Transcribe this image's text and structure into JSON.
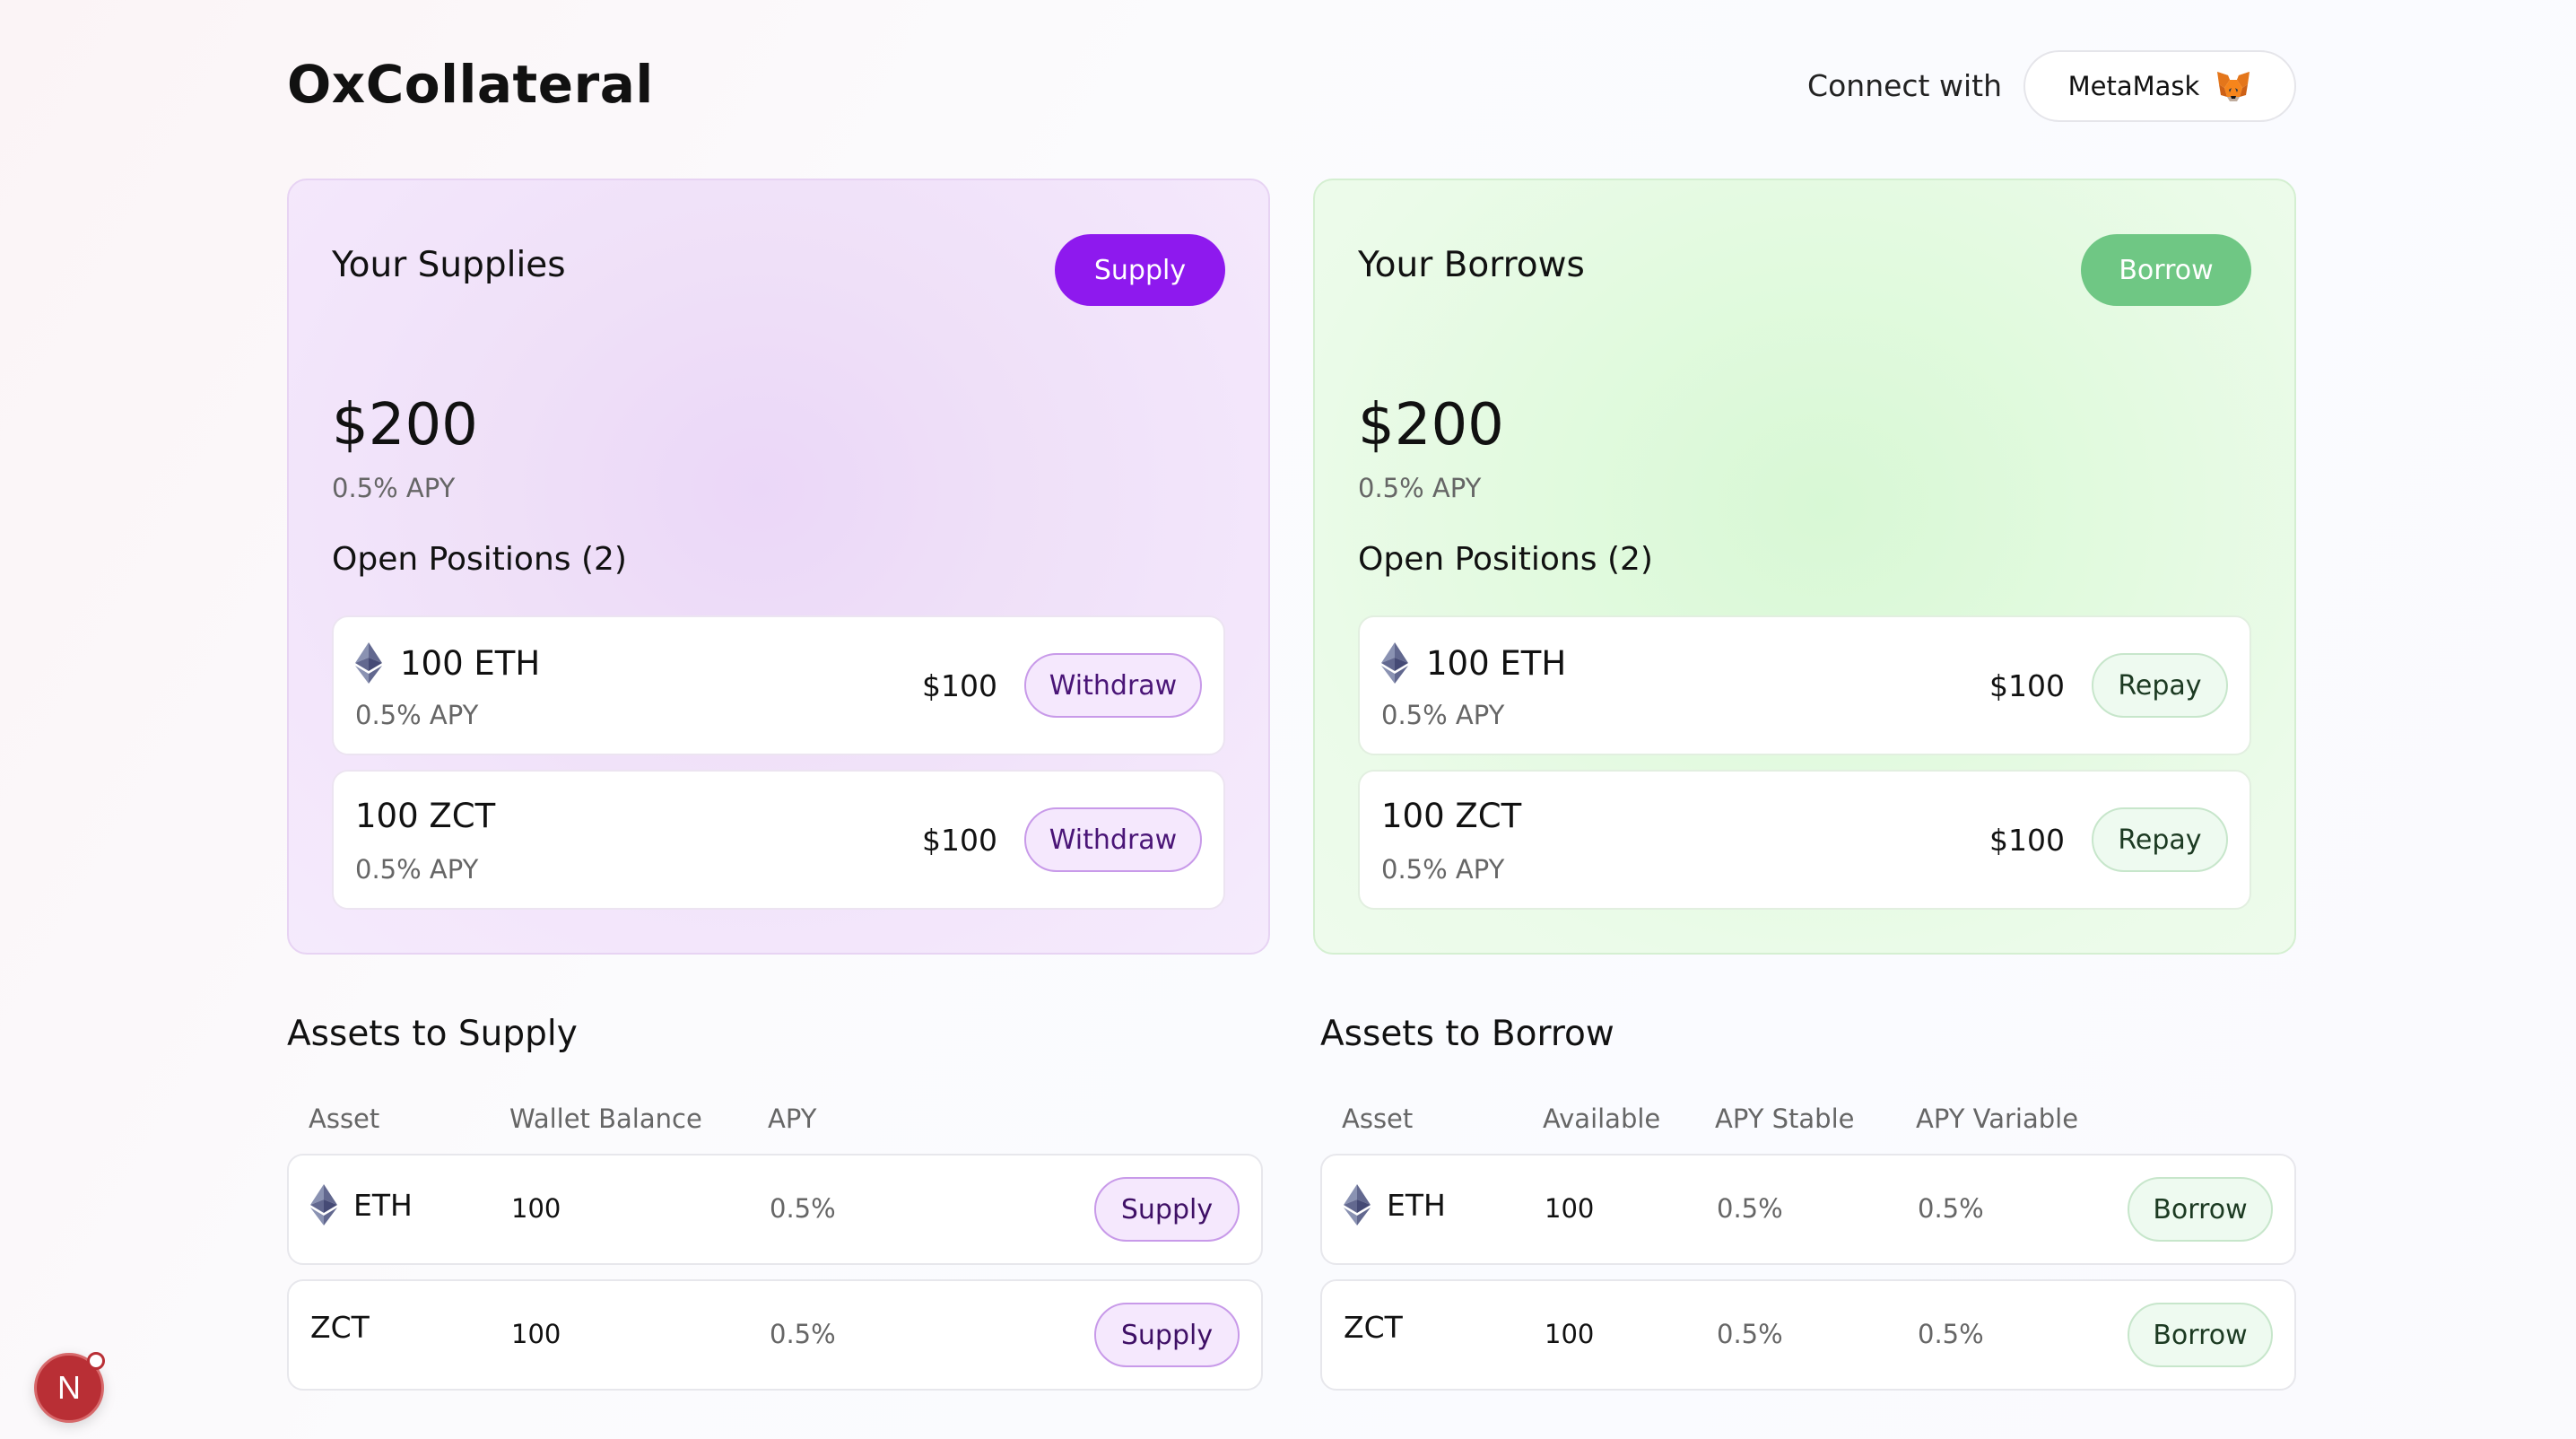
{
  "header": {
    "logo": "OxCollateral",
    "connect_label": "Connect with",
    "wallet_button": "MetaMask",
    "wallet_icon": "metamask-fox-icon"
  },
  "supplies_card": {
    "title": "Your Supplies",
    "action_label": "Supply",
    "amount": "$200",
    "apy": "0.5% APY",
    "open_positions_label": "Open Positions (2)",
    "positions": [
      {
        "asset": "100 ETH",
        "icon": "eth-icon",
        "apy": "0.5% APY",
        "usd": "$100",
        "button": "Withdraw"
      },
      {
        "asset": "100 ZCT",
        "apy": "0.5% APY",
        "usd": "$100",
        "button": "Withdraw"
      }
    ],
    "accent": "#8e19ee"
  },
  "borrows_card": {
    "title": "Your Borrows",
    "action_label": "Borrow",
    "amount": "$200",
    "apy": "0.5% APY",
    "open_positions_label": "Open Positions (2)",
    "positions": [
      {
        "asset": "100 ETH",
        "icon": "eth-icon",
        "apy": "0.5% APY",
        "usd": "$100",
        "button": "Repay"
      },
      {
        "asset": "100 ZCT",
        "apy": "0.5% APY",
        "usd": "$100",
        "button": "Repay"
      }
    ],
    "accent": "#6fc784"
  },
  "assets_to_supply": {
    "title": "Assets to Supply",
    "columns": [
      "Asset",
      "Wallet Balance",
      "APY"
    ],
    "rows": [
      {
        "asset": "ETH",
        "icon": "eth-icon",
        "balance": "100",
        "apy": "0.5%",
        "button": "Supply"
      },
      {
        "asset": "ZCT",
        "balance": "100",
        "apy": "0.5%",
        "button": "Supply"
      }
    ]
  },
  "assets_to_borrow": {
    "title": "Assets to Borrow",
    "columns": [
      "Asset",
      "Available",
      "APY Stable",
      "APY Variable"
    ],
    "rows": [
      {
        "asset": "ETH",
        "icon": "eth-icon",
        "available": "100",
        "apy_stable": "0.5%",
        "apy_variable": "0.5%",
        "button": "Borrow"
      },
      {
        "asset": "ZCT",
        "available": "100",
        "apy_stable": "0.5%",
        "apy_variable": "0.5%",
        "button": "Borrow"
      }
    ]
  },
  "dev_badge": {
    "letter": "N"
  }
}
